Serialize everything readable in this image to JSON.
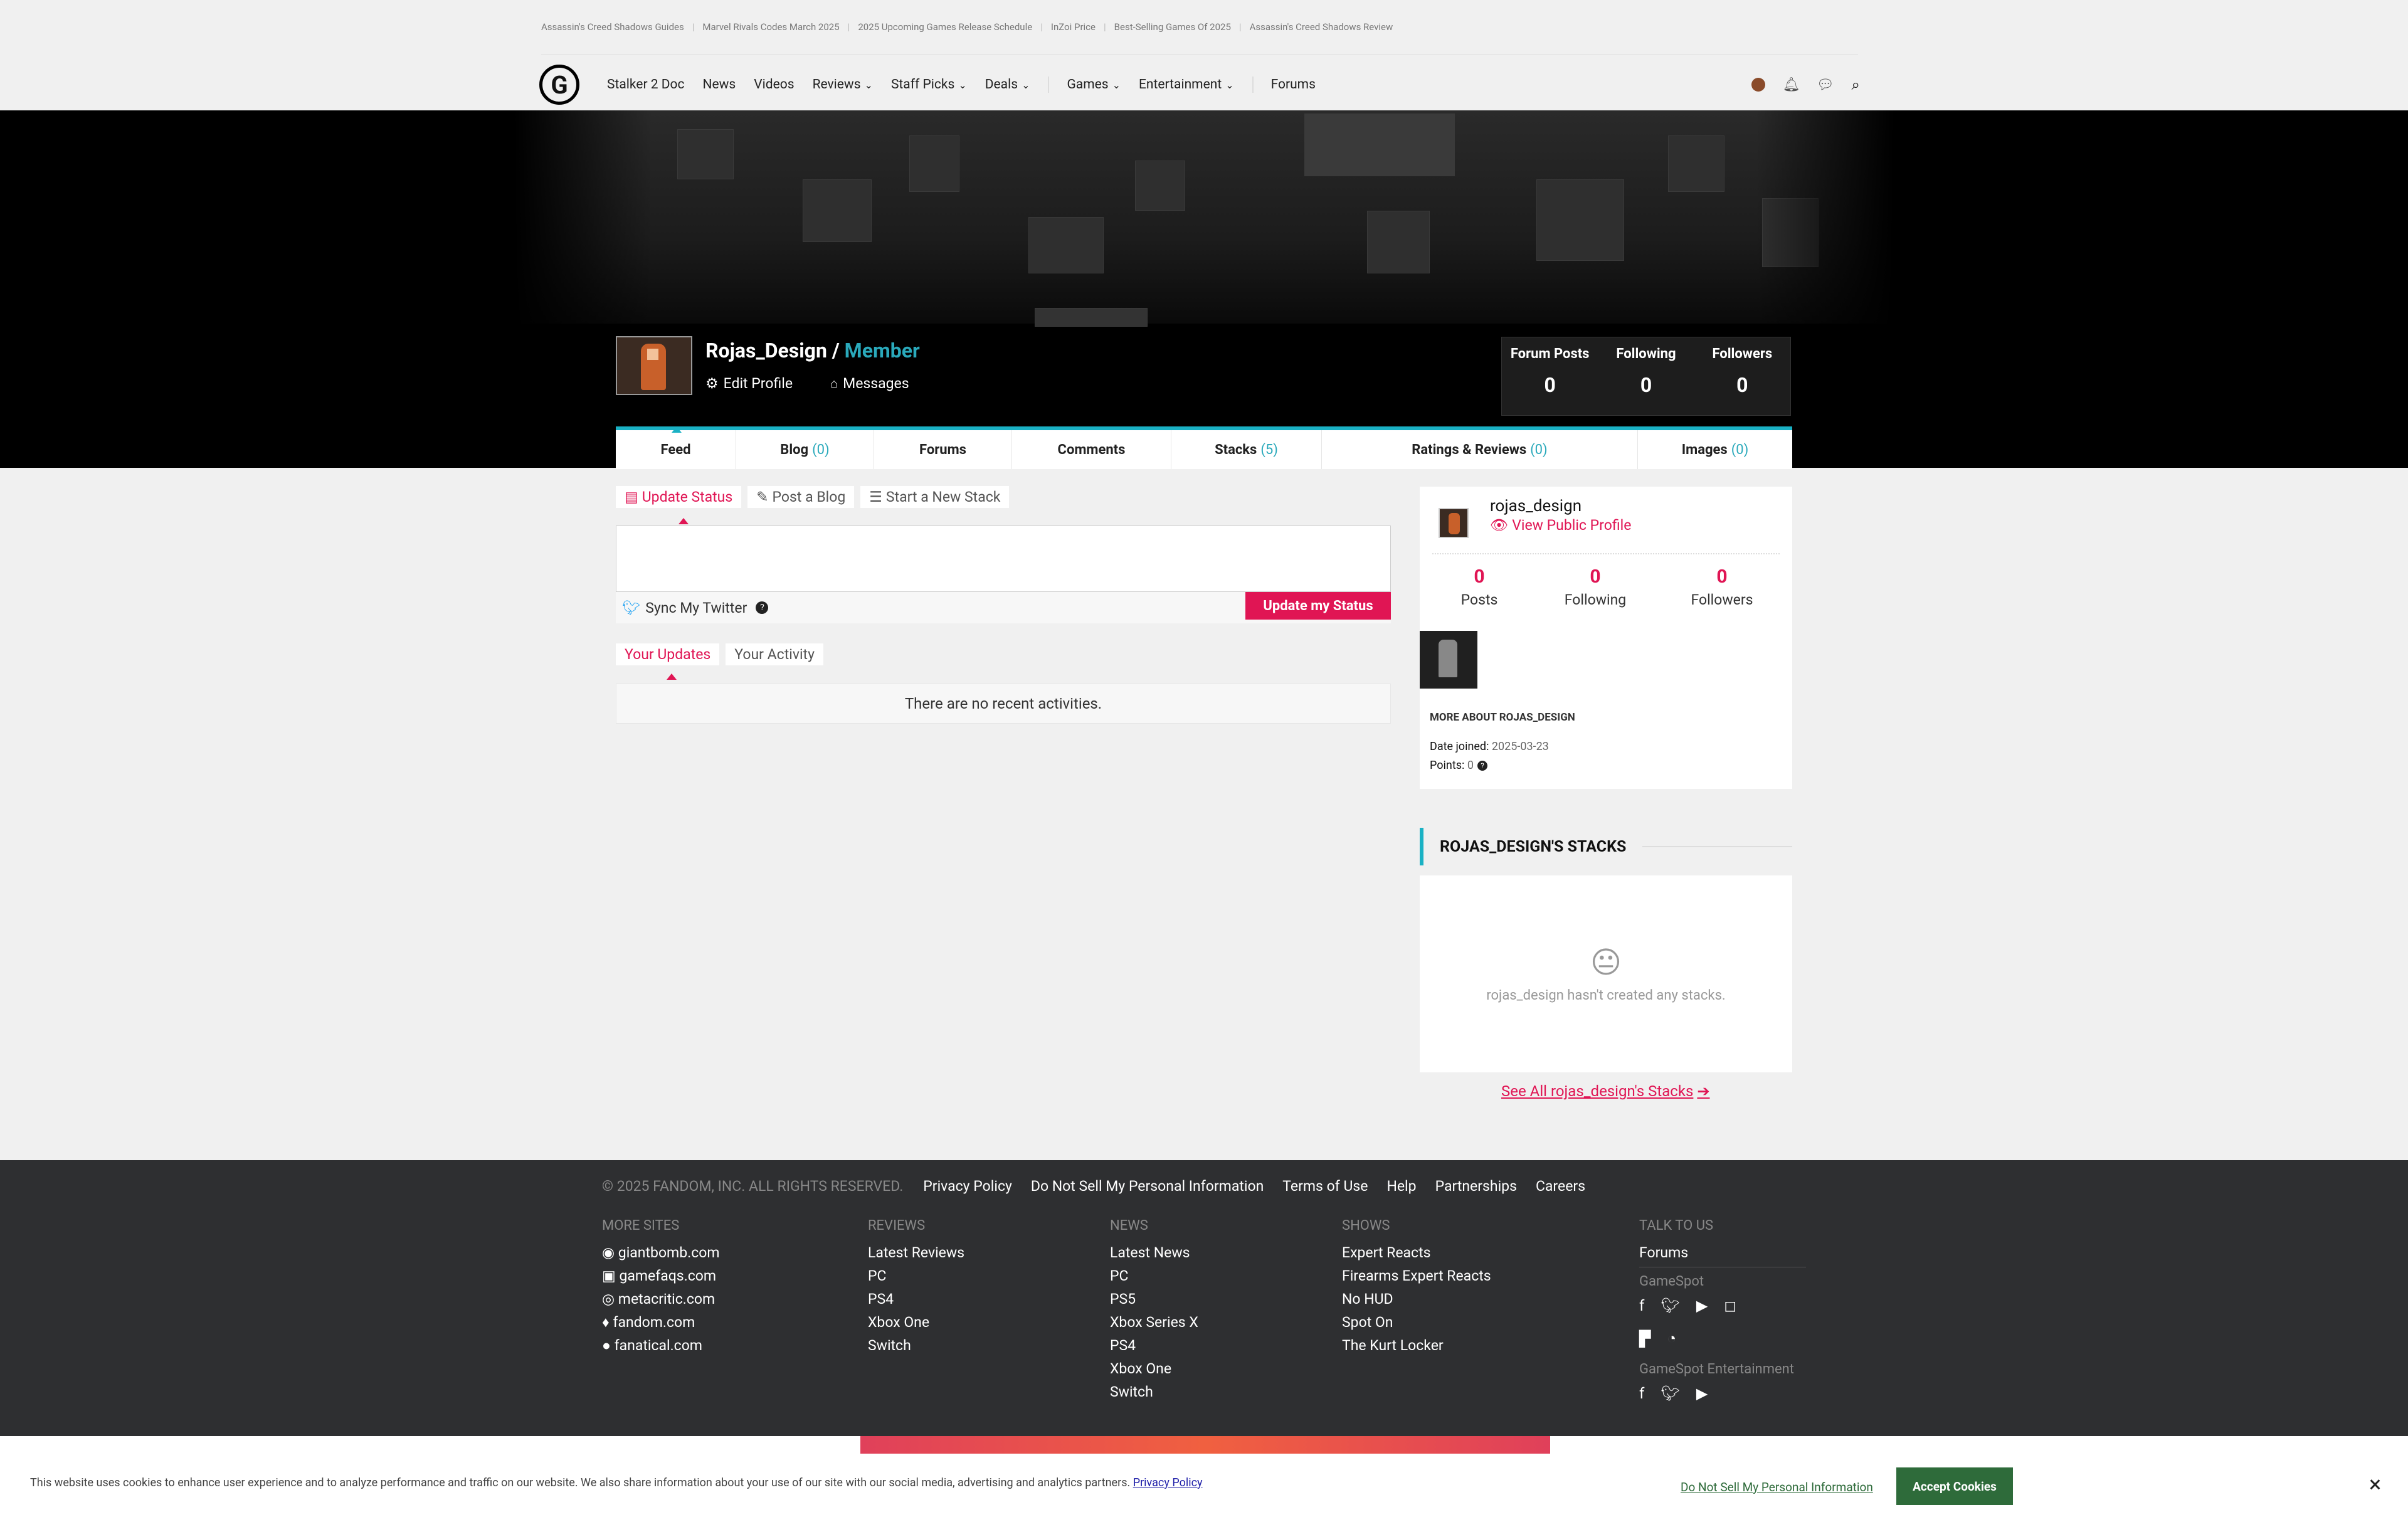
{
  "top_links": [
    "Assassin's Creed Shadows Guides",
    "Marvel Rivals Codes March 2025",
    "2025 Upcoming Games Release Schedule",
    "InZoi Price",
    "Best-Selling Games Of 2025",
    "Assassin's Creed Shadows Review"
  ],
  "nav": {
    "logo": "G",
    "items": [
      "Stalker 2 Doc",
      "News",
      "Videos",
      "Reviews",
      "Staff Picks",
      "Deals",
      "Games",
      "Entertainment",
      "Forums"
    ]
  },
  "profile": {
    "name": "Rojas_Design",
    "slash": " / ",
    "role": "Member",
    "edit_profile": "Edit Profile",
    "messages": "Messages",
    "stats": [
      {
        "label": "Forum Posts",
        "value": "0"
      },
      {
        "label": "Following",
        "value": "0"
      },
      {
        "label": "Followers",
        "value": "0"
      }
    ]
  },
  "tabs": [
    {
      "label": "Feed",
      "count": ""
    },
    {
      "label": "Blog",
      "count": "(0)"
    },
    {
      "label": "Forums",
      "count": ""
    },
    {
      "label": "Comments",
      "count": ""
    },
    {
      "label": "Stacks",
      "count": "(5)"
    },
    {
      "label": "Ratings & Reviews",
      "count": "(0)"
    },
    {
      "label": "Images",
      "count": "(0)"
    }
  ],
  "post_tabs": [
    "Update Status",
    "Post a Blog",
    "Start a New Stack"
  ],
  "sync_twitter": "Sync My Twitter",
  "update_button": "Update my Status",
  "update_tabs": [
    "Your Updates",
    "Your Activity"
  ],
  "no_activity": "There are no recent activities.",
  "card": {
    "username": "rojas_design",
    "view_public": "View Public Profile",
    "stats": [
      {
        "label": "Posts",
        "value": "0"
      },
      {
        "label": "Following",
        "value": "0"
      },
      {
        "label": "Followers",
        "value": "0"
      }
    ],
    "more_about": "MORE ABOUT ROJAS_DESIGN",
    "date_joined_label": "Date joined:",
    "date_joined": "2025-03-23",
    "points_label": "Points:",
    "points": "0"
  },
  "stacks": {
    "heading": "ROJAS_DESIGN'S STACKS",
    "empty": "rojas_design hasn't created any stacks.",
    "see_all": "See All rojas_design's Stacks"
  },
  "footer": {
    "copyright": "© 2025 FANDOM, INC. ALL RIGHTS RESERVED.",
    "links": [
      "Privacy Policy",
      "Do Not Sell My Personal Information",
      "Terms of Use",
      "Help",
      "Partnerships",
      "Careers"
    ],
    "more_sites": {
      "heading": "MORE SITES",
      "items": [
        "giantbomb.com",
        "gamefaqs.com",
        "metacritic.com",
        "fandom.com",
        "fanatical.com"
      ]
    },
    "reviews": {
      "heading": "REVIEWS",
      "items": [
        "Latest Reviews",
        "PC",
        "PS4",
        "Xbox One",
        "Switch"
      ]
    },
    "news": {
      "heading": "NEWS",
      "items": [
        "Latest News",
        "PC",
        "PS5",
        "Xbox Series X",
        "PS4",
        "Xbox One",
        "Switch"
      ]
    },
    "shows": {
      "heading": "SHOWS",
      "items": [
        "Expert Reacts",
        "Firearms Expert Reacts",
        "No HUD",
        "Spot On",
        "The Kurt Locker"
      ]
    },
    "talk": {
      "heading": "TALK TO US",
      "forums": "Forums",
      "gamespot": "GameSpot",
      "gamespot_ent": "GameSpot Entertainment"
    }
  },
  "cookie": {
    "text": "This website uses cookies to enhance user experience and to analyze performance and traffic on our website. We also share information about your use of our site with our social media, advertising and analytics partners.",
    "privacy": "Privacy Policy",
    "dnsmpi": "Do Not Sell My Personal Information",
    "accept": "Accept Cookies",
    "close": "×"
  },
  "colors": {
    "accent": "#e01554",
    "teal": "#1ab1c4",
    "footer": "#2e2f31",
    "accept": "#2e6b3a"
  }
}
